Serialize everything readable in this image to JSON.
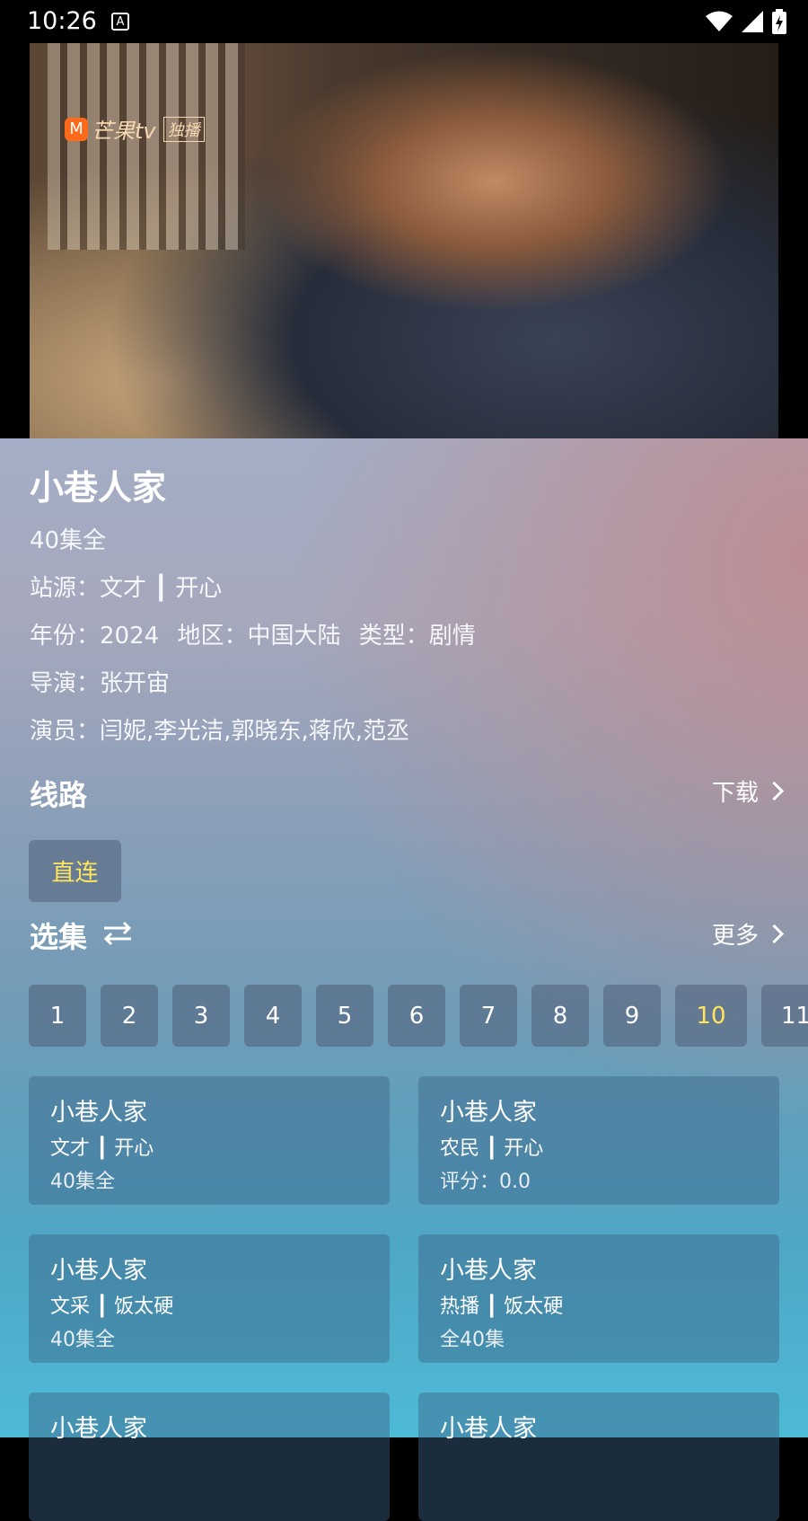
{
  "status": {
    "time": "10:26",
    "notification_icon": "A"
  },
  "video": {
    "logo_text": "芒果tv",
    "logo_badge": "独播"
  },
  "show": {
    "title": "小巷人家",
    "episodes": "40集全",
    "source_label": "站源：",
    "source_value": "文才 ┃ 开心",
    "year_label": "年份：",
    "year_value": "2024",
    "region_label": "地区：",
    "region_value": "中国大陆",
    "type_label": "类型：",
    "type_value": "剧情",
    "director_label": "导演：",
    "director_value": "张开宙",
    "cast_label": "演员：",
    "cast_value": "闫妮,李光洁,郭晓东,蒋欣,范丞"
  },
  "routes": {
    "title": "线路",
    "download": "下载",
    "items": [
      "直连"
    ]
  },
  "episode_section": {
    "title": "选集",
    "more": "更多",
    "items": [
      "1",
      "2",
      "3",
      "4",
      "5",
      "6",
      "7",
      "8",
      "9",
      "10",
      "11"
    ],
    "selected": "10"
  },
  "related": [
    {
      "title": "小巷人家",
      "line2": "文才 ┃ 开心",
      "line3": "40集全"
    },
    {
      "title": "小巷人家",
      "line2": "农民 ┃ 开心",
      "line3": "评分：0.0"
    },
    {
      "title": "小巷人家",
      "line2": "文采 ┃ 饭太硬",
      "line3": "40集全"
    },
    {
      "title": "小巷人家",
      "line2": "热播 ┃ 饭太硬",
      "line3": "全40集"
    },
    {
      "title": "小巷人家",
      "line2": "",
      "line3": ""
    },
    {
      "title": "小巷人家",
      "line2": "",
      "line3": ""
    }
  ],
  "colors": {
    "selected_episode": "#ffe55c"
  }
}
